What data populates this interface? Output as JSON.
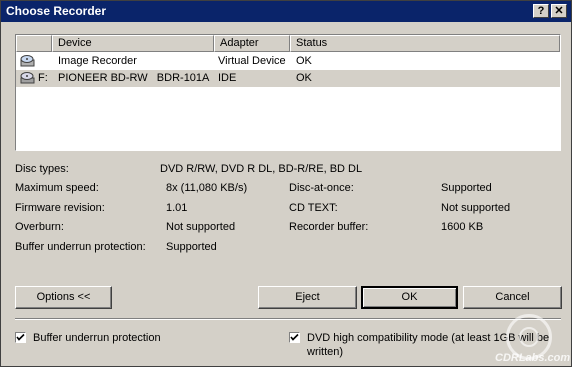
{
  "window": {
    "title": "Choose Recorder",
    "help_glyph": "?",
    "close_glyph": "✕"
  },
  "list": {
    "headers": [
      "Device",
      "Adapter",
      "Status"
    ],
    "rows": [
      {
        "icon": "image-recorder-icon",
        "letter": "",
        "device": "Image Recorder",
        "adapter": "Virtual Device",
        "status": "OK"
      },
      {
        "icon": "drive-icon",
        "letter": "F:",
        "device": "PIONEER BD-RW   BDR-101A",
        "adapter": "IDE",
        "status": "OK"
      }
    ]
  },
  "disc_types": {
    "label": "Disc types:",
    "value": "DVD R/RW, DVD R DL, BD-R/RE, BD DL"
  },
  "info_left": [
    {
      "label": "Maximum speed:",
      "value": "8x (11,080 KB/s)"
    },
    {
      "label": "Firmware revision:",
      "value": "1.01"
    },
    {
      "label": "Overburn:",
      "value": "Not supported"
    },
    {
      "label": "Buffer underrun protection:",
      "value": "Supported"
    }
  ],
  "info_right": [
    {
      "label": "Disc-at-once:",
      "value": "Supported"
    },
    {
      "label": "CD TEXT:",
      "value": "Not supported"
    },
    {
      "label": "Recorder buffer:",
      "value": "1600 KB"
    }
  ],
  "buttons": {
    "options": "Options <<",
    "eject": "Eject",
    "ok": "OK",
    "cancel": "Cancel"
  },
  "checkboxes": {
    "buffer_underrun": {
      "label": "Buffer underrun protection",
      "checked": true
    },
    "dvd_compat": {
      "label": "DVD high compatibility mode (at least 1GB will be written)",
      "checked": true
    }
  },
  "watermark": {
    "text": "CDRLabs.com"
  }
}
